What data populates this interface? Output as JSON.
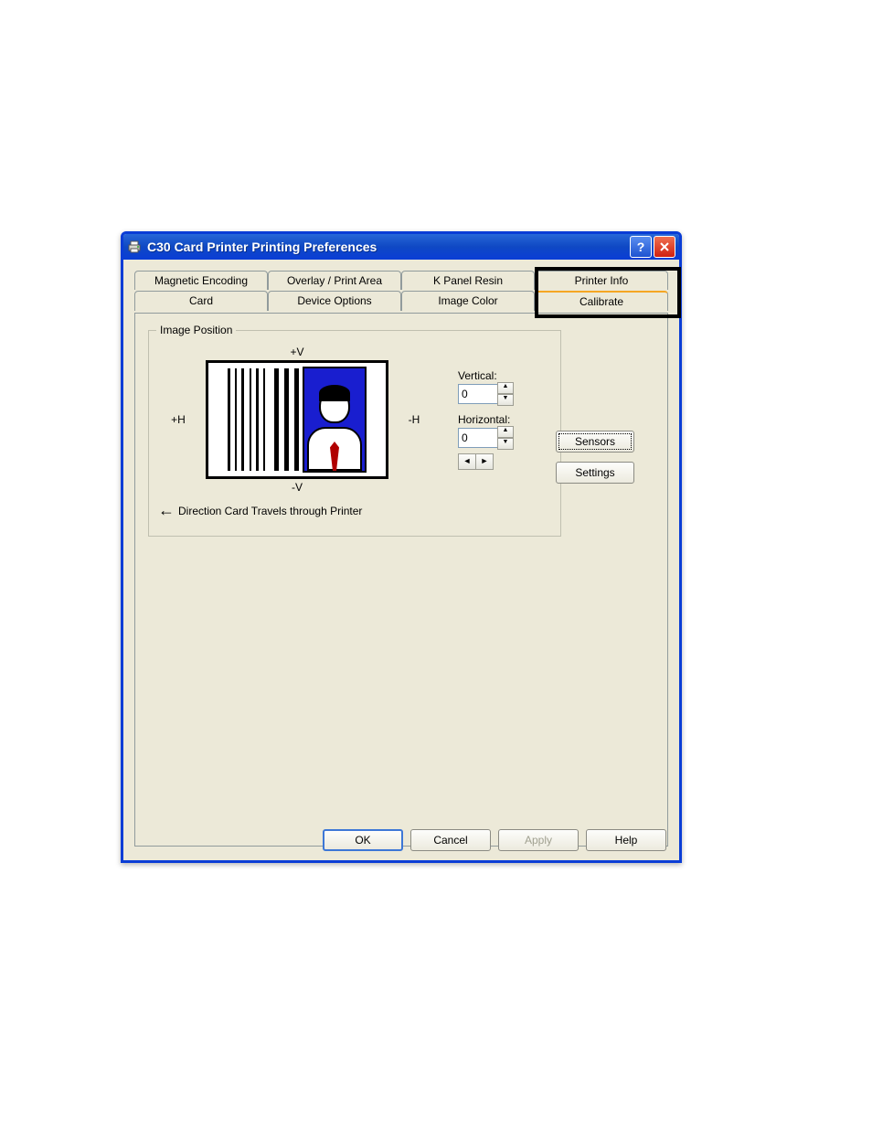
{
  "window": {
    "title": "C30 Card Printer Printing Preferences"
  },
  "tabs": {
    "row1": [
      "Magnetic Encoding",
      "Overlay / Print Area",
      "K Panel Resin",
      "Printer Info"
    ],
    "row2": [
      "Card",
      "Device Options",
      "Image Color",
      "Calibrate"
    ],
    "active": "Calibrate"
  },
  "group": {
    "title": "Image Position",
    "plusV": "+V",
    "minusV": "-V",
    "plusH": "+H",
    "minusH": "-H",
    "direction": "Direction Card Travels through Printer"
  },
  "fields": {
    "verticalLabel": "Vertical:",
    "verticalValue": "0",
    "horizontalLabel": "Horizontal:",
    "horizontalValue": "0"
  },
  "sideButtons": {
    "sensors": "Sensors",
    "settings": "Settings"
  },
  "buttons": {
    "ok": "OK",
    "cancel": "Cancel",
    "apply": "Apply",
    "help": "Help"
  }
}
